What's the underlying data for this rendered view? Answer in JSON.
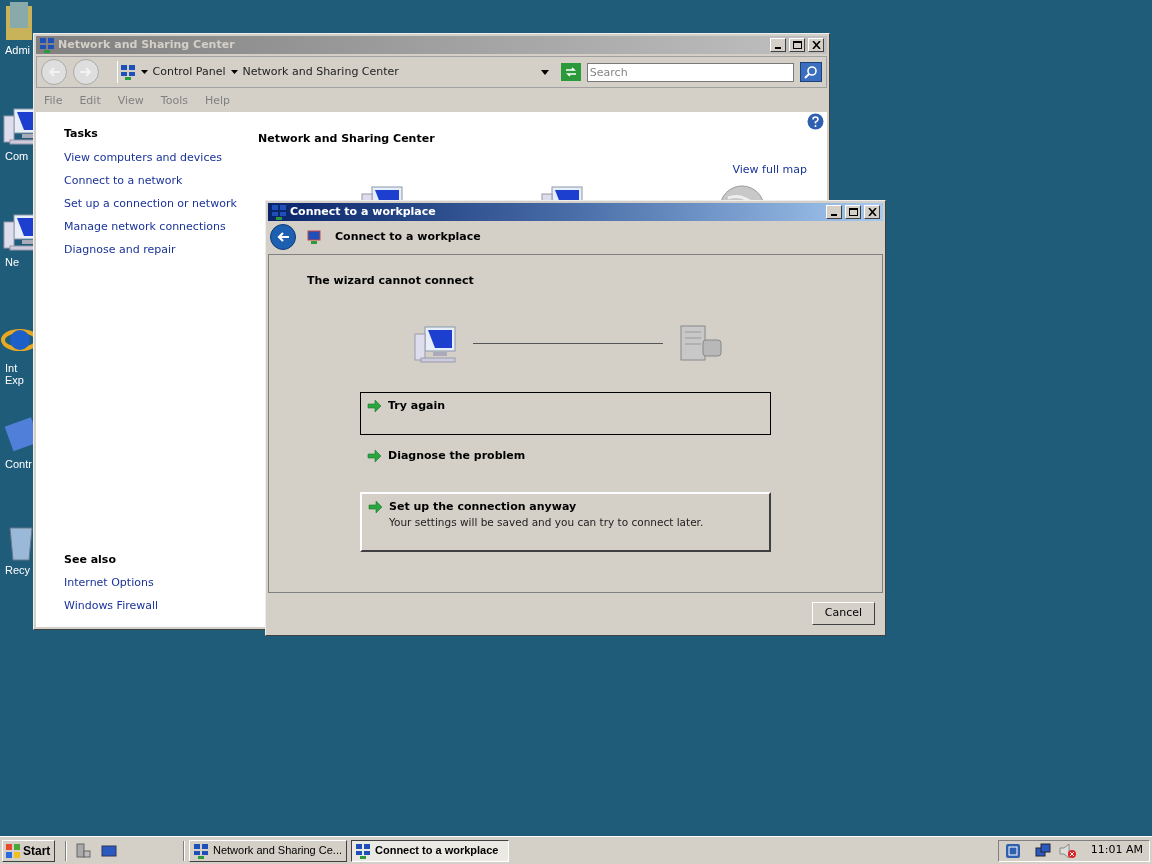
{
  "desktop_icons": [
    {
      "lines": [
        "Admi"
      ]
    },
    {
      "lines": [
        "Com"
      ]
    },
    {
      "lines": [
        "Ne"
      ]
    },
    {
      "lines": [
        "Int",
        "Exp"
      ]
    },
    {
      "lines": [
        "Contr"
      ]
    },
    {
      "lines": [
        "Recy"
      ]
    }
  ],
  "main_window": {
    "title": "Network and Sharing Center",
    "active": false,
    "breadcrumb": [
      "Control Panel",
      "Network and Sharing Center"
    ],
    "search": {
      "placeholder": "Search"
    },
    "menu": [
      "File",
      "Edit",
      "View",
      "Tools",
      "Help"
    ],
    "tasks": {
      "heading": "Tasks",
      "links": [
        "View computers and devices",
        "Connect to a network",
        "Set up a connection or network",
        "Manage network connections",
        "Diagnose and repair"
      ]
    },
    "see_also": {
      "heading": "See also",
      "links": [
        "Internet Options",
        "Windows Firewall"
      ]
    },
    "heading": "Network and Sharing Center",
    "view_full_map": "View full map"
  },
  "dialog": {
    "title": "Connect to a workplace",
    "active": true,
    "header": "Connect to a workplace",
    "message": "The wizard cannot connect",
    "options": [
      {
        "label": "Try again",
        "focused": true,
        "hover": false
      },
      {
        "label": "Diagnose the problem",
        "focused": false,
        "hover": false
      },
      {
        "label": "Set up the connection anyway",
        "description": "Your settings will be saved and you can try to connect later.",
        "focused": false,
        "hover": true
      }
    ],
    "buttons": [
      "Cancel"
    ]
  },
  "taskbar": {
    "start": "Start",
    "tasks": [
      {
        "label": "Network and Sharing Ce...",
        "selected": false
      },
      {
        "label": "Connect to a workplace",
        "selected": true
      }
    ],
    "clock": "11:01 AM"
  }
}
